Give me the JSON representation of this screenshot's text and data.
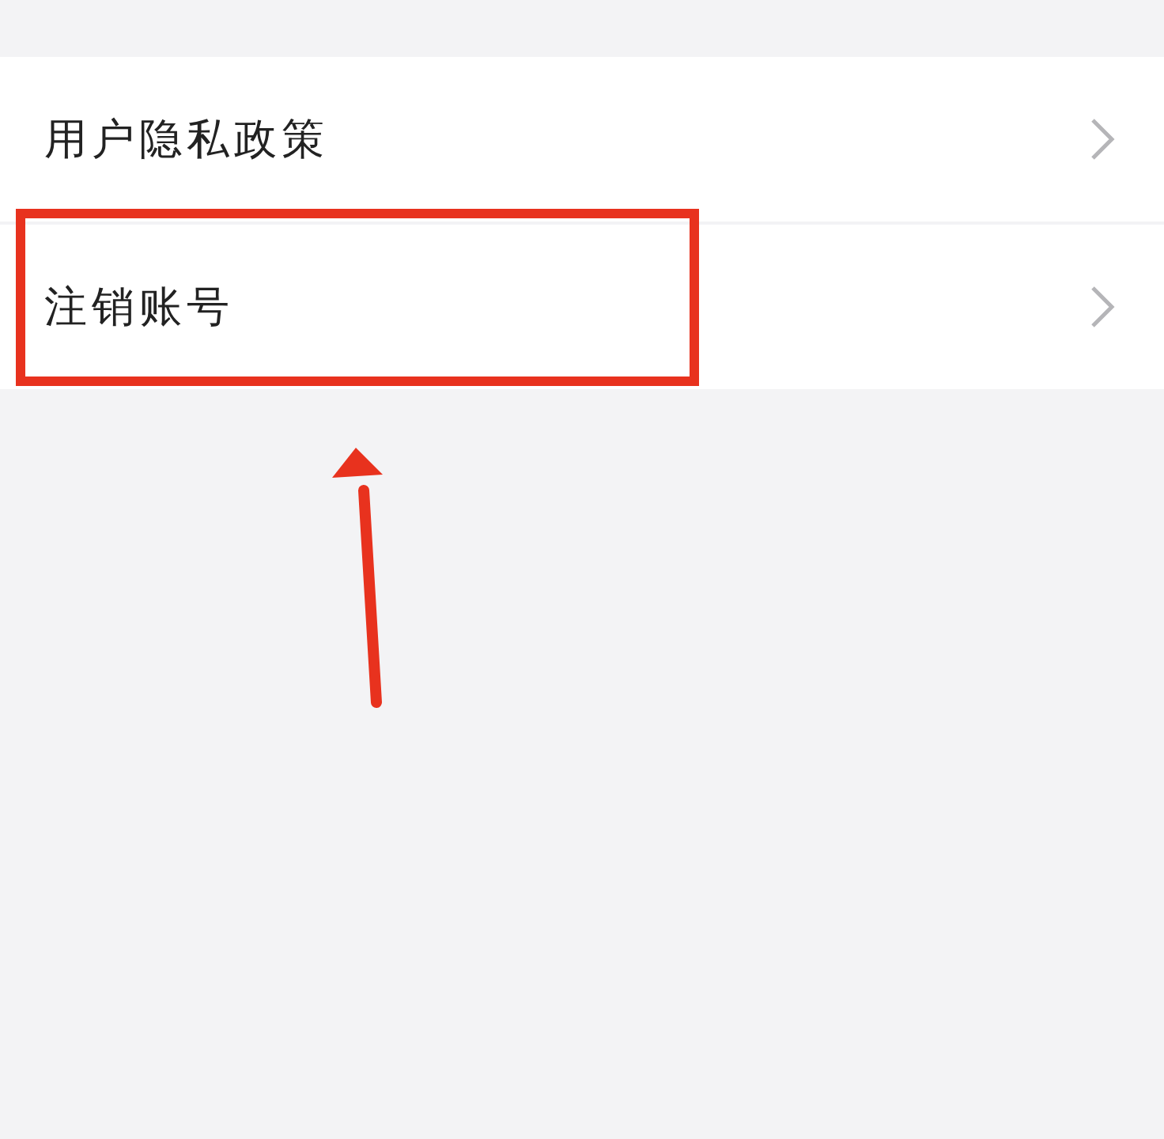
{
  "settings_list": {
    "items": [
      {
        "label": "用户隐私政策",
        "highlighted": false
      },
      {
        "label": "注销账号",
        "highlighted": true
      }
    ]
  }
}
